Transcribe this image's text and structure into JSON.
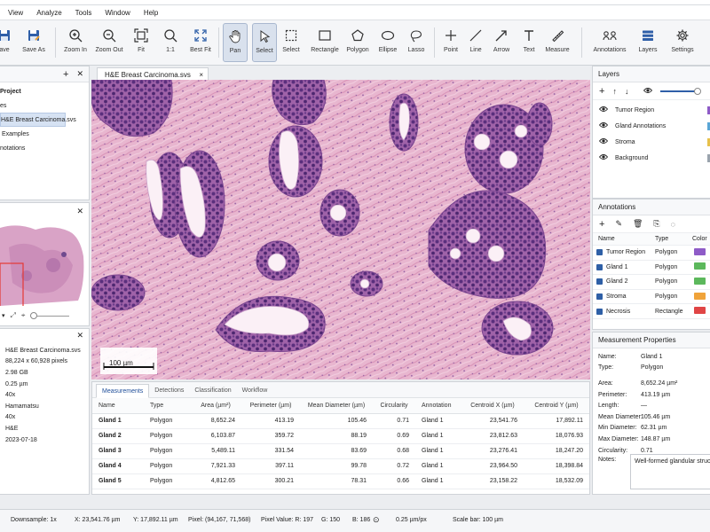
{
  "menu": [
    "View",
    "Analyze",
    "Tools",
    "Window",
    "Help"
  ],
  "toolbar": [
    {
      "label": "ave",
      "icon": "save-icon"
    },
    {
      "label": "Save As",
      "icon": "save-as-icon"
    },
    {
      "label": "Zoom In",
      "icon": "zoom-in-icon"
    },
    {
      "label": "Zoom Out",
      "icon": "zoom-out-icon"
    },
    {
      "label": "Fit",
      "icon": "fit-icon"
    },
    {
      "label": "1:1",
      "icon": "actual-size-icon"
    },
    {
      "label": "Best Fit",
      "icon": "best-fit-icon"
    },
    {
      "label": "Pan",
      "icon": "hand-icon"
    },
    {
      "label": "Select",
      "icon": "pointer-icon"
    },
    {
      "label": "Select",
      "icon": "select-box-icon"
    },
    {
      "label": "Rectangle",
      "icon": "rectangle-icon"
    },
    {
      "label": "Polygon",
      "icon": "polygon-icon"
    },
    {
      "label": "Ellipse",
      "icon": "ellipse-icon"
    },
    {
      "label": "Lasso",
      "icon": "lasso-icon"
    },
    {
      "label": "Point",
      "icon": "point-icon"
    },
    {
      "label": "Line",
      "icon": "line-icon"
    },
    {
      "label": "Arrow",
      "icon": "arrow-icon"
    },
    {
      "label": "Text",
      "icon": "text-icon"
    },
    {
      "label": "Measure",
      "icon": "ruler-icon"
    },
    {
      "label": "Annotations",
      "icon": "annotations-icon"
    },
    {
      "label": "Layers",
      "icon": "layers-icon"
    },
    {
      "label": "Settings",
      "icon": "gear-icon"
    }
  ],
  "project": {
    "items": [
      {
        "label": "Project",
        "bold": true
      },
      {
        "label": "es",
        "bold": false
      },
      {
        "label": "H&E Breast Carcinoma.svs",
        "bold": false,
        "selected": true
      },
      {
        "label": "Examples",
        "bold": false
      },
      {
        "label": "notations",
        "bold": false
      }
    ]
  },
  "image_info": [
    "H&E Breast Carcinoma.svs",
    "88,224 x 60,928 pixels",
    "2.98 GB",
    "0.25 µm",
    "40x",
    "Hamamatsu",
    "40x",
    "H&E",
    "2023-07-18"
  ],
  "viewer": {
    "tab_label": "H&E Breast Carcinoma.svs",
    "tab_close": "×",
    "scale_label": "100 µm"
  },
  "measurements": {
    "tabs": [
      "Measurements",
      "Detections",
      "Classification",
      "Workflow"
    ],
    "columns": [
      "Name",
      "Type",
      "Area (µm²)",
      "Perimeter (µm)",
      "Mean Diameter (µm)",
      "Circularity",
      "Annotation",
      "Centroid X (µm)",
      "Centroid Y (µm)"
    ],
    "rows": [
      [
        "Gland 1",
        "Polygon",
        "8,652.24",
        "413.19",
        "105.46",
        "0.71",
        "Gland 1",
        "23,541.76",
        "17,892.11"
      ],
      [
        "Gland 2",
        "Polygon",
        "6,103.87",
        "359.72",
        "88.19",
        "0.69",
        "Gland 1",
        "23,812.63",
        "18,076.93"
      ],
      [
        "Gland 3",
        "Polygon",
        "5,489.11",
        "331.54",
        "83.69",
        "0.68",
        "Gland 1",
        "23,276.41",
        "18,247.20"
      ],
      [
        "Gland 4",
        "Polygon",
        "7,921.33",
        "397.11",
        "99.78",
        "0.72",
        "Gland 1",
        "23,964.50",
        "18,398.84"
      ],
      [
        "Gland 5",
        "Polygon",
        "4,812.65",
        "300.21",
        "78.31",
        "0.66",
        "Gland 1",
        "23,158.22",
        "18,532.09"
      ]
    ]
  },
  "layers": {
    "title": "Layers",
    "items": [
      {
        "name": "Tumor Region",
        "color": "#8e5bc7"
      },
      {
        "name": "Gland Annotations",
        "color": "#5aa6d6"
      },
      {
        "name": "Stroma",
        "color": "#e7c14b"
      },
      {
        "name": "Background",
        "color": "#9aa3ad"
      }
    ]
  },
  "annotations": {
    "title": "Annotations",
    "columns": [
      "Name",
      "Type",
      "Color"
    ],
    "rows": [
      {
        "name": "Tumor Region",
        "type": "Polygon",
        "color": "#8e5bc7"
      },
      {
        "name": "Gland 1",
        "type": "Polygon",
        "color": "#5cb85c"
      },
      {
        "name": "Gland 2",
        "type": "Polygon",
        "color": "#5cb85c"
      },
      {
        "name": "Stroma",
        "type": "Polygon",
        "color": "#f0a33a"
      },
      {
        "name": "Necrosis",
        "type": "Rectangle",
        "color": "#e04545"
      }
    ]
  },
  "properties": {
    "title": "Measurement Properties",
    "rows": [
      [
        "Name:",
        "Gland 1"
      ],
      [
        "Type:",
        "Polygon"
      ],
      [
        "",
        ""
      ],
      [
        "Area:",
        "8,652.24 µm²"
      ],
      [
        "Perimeter:",
        "413.19 µm"
      ],
      [
        "Length:",
        "—"
      ],
      [
        "Mean Diameter:",
        "105.46 µm"
      ],
      [
        "Min Diameter:",
        "62.31 µm"
      ],
      [
        "Max Diameter:",
        "148.87 µm"
      ],
      [
        "Circularity:",
        "0.71"
      ]
    ],
    "notes_label": "Notes:",
    "notes_text": "Well-formed glandular structure."
  },
  "status": {
    "downsample": "Downsample: 1x",
    "x": "X: 23,541.76 µm",
    "y": "Y: 17,892.11 µm",
    "pixel": "Pixel: (94,167, 71,568)",
    "pixel_value": "Pixel Value: R: 197",
    "g": "G: 150",
    "b": "B: 186",
    "resolution": "0.25 µm/px",
    "scale_bar": "Scale bar: 100 µm"
  }
}
